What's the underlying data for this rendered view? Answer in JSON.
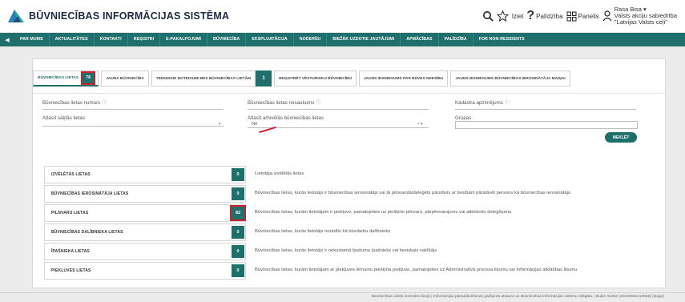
{
  "header": {
    "title": "BŪVNIECĪBAS INFORMĀCIJAS SISTĒMA",
    "logout": "Iziet",
    "help": "Palīdzība",
    "panel": "Panelis",
    "user_name": "Rasa Bisa ▾",
    "user_org_1": "Valsts akciju sabiedrība",
    "user_org_2": "\"Latvijas Valsts ceļi\""
  },
  "nav": {
    "items": [
      "PAR MUMS",
      "AKTUALITĀTES",
      "KONTAKTI",
      "REĢISTRI",
      "E-PAKALPOJUMI",
      "BŪVNIECĪBA",
      "EKSPLUATĀCIJA",
      "NODERĪGI",
      "BIEŽĀK UZDOTIE JAUTĀJUMI",
      "APMĀCĪBAS",
      "PALĪDZĪBA",
      "FOR NON-RESIDENTS"
    ]
  },
  "tabs": {
    "t1_label": "BŪVNIECĪBAS LIETAS",
    "t1_count": "76",
    "t2_label": "JAUNA BŪVNIECĪBA",
    "t3_label": "TEHNISKIE NOTEIKUMI BEZ BŪVNIECĪBAS LIETĀM",
    "t3_count": "1",
    "t4_label": "REĢISTRĒT VĒSTURISKU BŪVNIECĪBU",
    "t5_label": "JAUNS IESNIEGUMS PAR BŪVES NEESĪBU",
    "t6_label": "JAUNS IESNIEGUMS BŪVNIECĪBAS IEROSINĀTĀJA MAIŅAI"
  },
  "filters": {
    "case_number_label": "Būvniecības lietas numurs",
    "case_name_label": "Būvniecības lietas nosaukums",
    "cadastre_label": "Kadastra apzīmējums",
    "selected_label": "Atlasīt sāķtās lietas",
    "archived_label": "Atlasīt arhivētās būvniecības lietas",
    "archived_value": "Nē",
    "archived_clear": "× ▾",
    "groups_label": "Grupas",
    "search_button": "MEKLĒT"
  },
  "rows": [
    {
      "label": "IZVĒLĒTĀS LIETAS",
      "count": "0",
      "desc": "Lietotāja izvēlētās lietas"
    },
    {
      "label": "BŪVNIECĪBAS IEROSINĀTĀJA LIETAS",
      "count": "0",
      "desc": "Būvniecības lietas, kurās lietotājs ir būvniecības ierosinātājs vai tā pilnvarotā/deleģēts pārstāvis ar tiesībām pārstāvēt personu kā būvniecības ierosinātāju"
    },
    {
      "label": "PILNVARU LIETAS",
      "count": "82",
      "desc": "Būvniecības lietas, kurām lietotājam ir piekļuve, pamatojoties uz piešķirto pilnvaru, pārpilnvarojumu vai atbilstošo deleģējumu"
    },
    {
      "label": "BŪVNIECĪBAS DALĪBNIEKA LIETAS",
      "count": "0",
      "desc": "Būvniecības lietas, kurās lietotājs norādīts kā būvdarbu dalībnieks"
    },
    {
      "label": "ĪPAŠNIEKA LIETAS",
      "count": "0",
      "desc": "Būvniecības lietas, kurās lietotājs ir nekustamā īpašuma īpašnieks vai tiesiskais valdītājs"
    },
    {
      "label": "PIEKĻUVES LIETAS",
      "count": "0",
      "desc": "Būvniecības lietas, kurām lietotājam ar piekļuves lēmumu piešķirta piekļuve, pamatojoties uz Administratīvā procesa likumu vai Informācijas atklātības likumu"
    }
  ],
  "footer": {
    "text": "Būvniecības valsts kontroles birojs | Informācijas pārpublicēšanas gadījumā atsauce uz Būvniecības informācijas sistēmu obligāta. | Build: 0ee52 (20230831210058) (stage)"
  },
  "colors": {
    "primary": "#1f6f6c",
    "highlight": "#d11f2b"
  }
}
